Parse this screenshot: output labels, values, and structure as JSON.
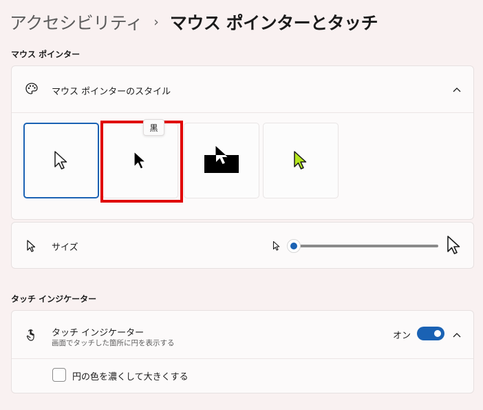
{
  "breadcrumb": {
    "parent": "アクセシビリティ",
    "separator": "›",
    "current": "マウス ポインターとタッチ"
  },
  "mouse_pointer_section": {
    "title": "マウス ポインター",
    "style_row": {
      "label": "マウス ポインターのスタイル",
      "icon": "palette-icon",
      "expanded": true
    },
    "styles": [
      {
        "id": "white",
        "selected": true
      },
      {
        "id": "black",
        "tooltip": "黒"
      },
      {
        "id": "inverted"
      },
      {
        "id": "custom",
        "color": "#b4e61e"
      }
    ],
    "size_row": {
      "label": "サイズ",
      "icon": "pointer-icon",
      "slider_value_fraction": 0.0
    }
  },
  "touch_section": {
    "title": "タッチ インジケーター",
    "row": {
      "label": "タッチ インジケーター",
      "sublabel": "画面でタッチした箇所に円を表示する",
      "icon": "touch-icon",
      "toggle_label": "オン",
      "toggle_on": true,
      "expanded": true
    },
    "checkbox": {
      "label": "円の色を濃くして大きくする",
      "checked": false
    }
  },
  "colors": {
    "accent": "#1a62b4",
    "highlight": "#e00000",
    "background": "#f9f1f1"
  }
}
